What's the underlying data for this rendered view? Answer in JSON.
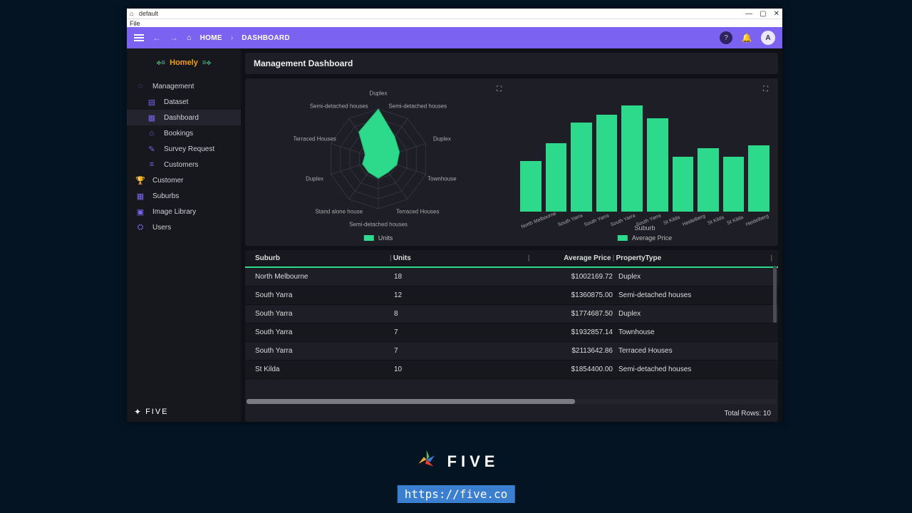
{
  "window": {
    "title": "default",
    "menu_file": "File",
    "btn_min": "—",
    "btn_max": "▢",
    "btn_close": "✕"
  },
  "appbar": {
    "home_label": "HOME",
    "crumb_dashboard": "DASHBOARD",
    "avatar_letter": "A"
  },
  "logo_text": "Homely",
  "sidebar": {
    "items": [
      {
        "icon": "lightbulb",
        "label": "Management",
        "indent": false,
        "active": false
      },
      {
        "icon": "dataset",
        "label": "Dataset",
        "indent": true,
        "active": false
      },
      {
        "icon": "dashboard",
        "label": "Dashboard",
        "indent": true,
        "active": true
      },
      {
        "icon": "home",
        "label": "Bookings",
        "indent": true,
        "active": false
      },
      {
        "icon": "clipboard",
        "label": "Survey Request",
        "indent": true,
        "active": false
      },
      {
        "icon": "list",
        "label": "Customers",
        "indent": true,
        "active": false
      },
      {
        "icon": "trophy",
        "label": "Customer",
        "indent": false,
        "active": false
      },
      {
        "icon": "grid",
        "label": "Suburbs",
        "indent": false,
        "active": false
      },
      {
        "icon": "image",
        "label": "Image Library",
        "indent": false,
        "active": false
      },
      {
        "icon": "users",
        "label": "Users",
        "indent": false,
        "active": false
      }
    ],
    "footer_brand": "FIVE"
  },
  "page_title": "Management Dashboard",
  "chart_data": [
    {
      "type": "radar",
      "title": "",
      "categories": [
        "Duplex",
        "Semi-detached houses",
        "Duplex",
        "Townhouse",
        "Terraced Houses",
        "Semi-detached houses",
        "Stand alone house",
        "Duplex",
        "Terraced Houses",
        "Semi-detached houses"
      ],
      "values": [
        18,
        10,
        8,
        7,
        6,
        7,
        6,
        6,
        5,
        12
      ],
      "legend": "Units",
      "max": 18
    },
    {
      "type": "bar",
      "xlabel": "Suburb",
      "categories": [
        "North Melbourne",
        "South Yarra",
        "South Yarra",
        "South Yarra",
        "South Yarra",
        "St Kilda",
        "Heidelberg",
        "St Kilda",
        "St Kilda",
        "Heidelberg"
      ],
      "values": [
        1002170,
        1360875,
        1774688,
        1932857,
        2113643,
        1854400,
        1100000,
        1260000,
        1100000,
        1320000
      ],
      "ylim": [
        0,
        2200000
      ],
      "legend": "Average Price"
    }
  ],
  "table": {
    "columns": [
      "Suburb",
      "Units",
      "Average Price",
      "PropertyType"
    ],
    "rows": [
      {
        "suburb": "North Melbourne",
        "units": "18",
        "price": "$1002169.72",
        "type": "Duplex"
      },
      {
        "suburb": "South Yarra",
        "units": "12",
        "price": "$1360875.00",
        "type": "Semi-detached houses"
      },
      {
        "suburb": "South Yarra",
        "units": "8",
        "price": "$1774687.50",
        "type": "Duplex"
      },
      {
        "suburb": "South Yarra",
        "units": "7",
        "price": "$1932857.14",
        "type": "Townhouse"
      },
      {
        "suburb": "South Yarra",
        "units": "7",
        "price": "$2113642.86",
        "type": "Terraced Houses"
      },
      {
        "suburb": "St Kilda",
        "units": "10",
        "price": "$1854400.00",
        "type": "Semi-detached houses"
      }
    ],
    "total_rows_label": "Total Rows: 10"
  },
  "footer": {
    "brand": "FIVE",
    "url": "https://five.co"
  }
}
